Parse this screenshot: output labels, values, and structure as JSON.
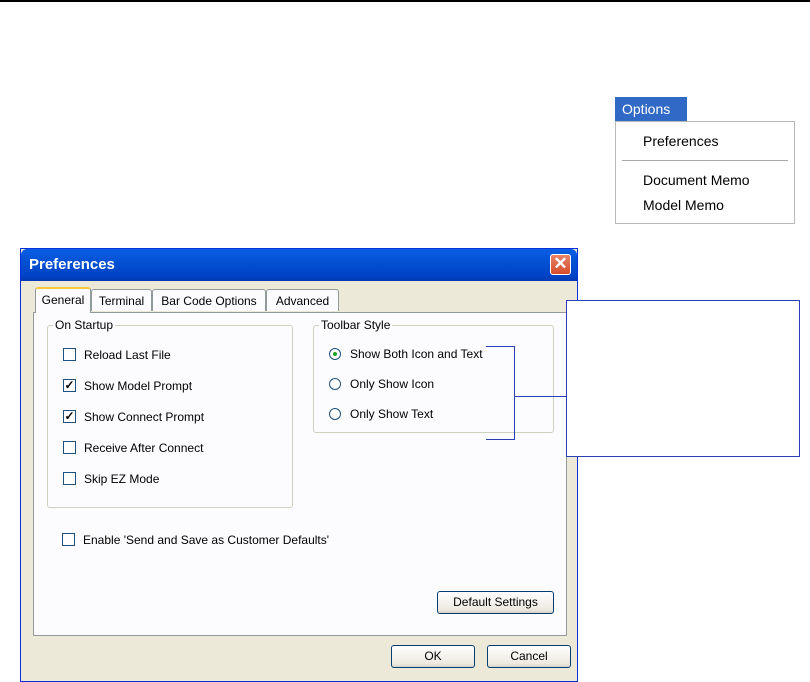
{
  "options_menu": {
    "title": "Options",
    "items": [
      "Preferences",
      "Document Memo",
      "Model Memo"
    ]
  },
  "dialog": {
    "title": "Preferences",
    "close_glyph": "✕",
    "tabs": [
      "General",
      "Terminal",
      "Bar Code Options",
      "Advanced"
    ],
    "active_tab": "General",
    "on_startup": {
      "legend": "On Startup",
      "options": [
        {
          "label": "Reload Last File",
          "checked": false
        },
        {
          "label": "Show Model Prompt",
          "checked": true
        },
        {
          "label": "Show Connect Prompt",
          "checked": true
        },
        {
          "label": "Receive After Connect",
          "checked": false
        },
        {
          "label": "Skip EZ Mode",
          "checked": false
        }
      ]
    },
    "toolbar_style": {
      "legend": "Toolbar Style",
      "options": [
        {
          "label": "Show Both Icon and Text",
          "selected": true
        },
        {
          "label": "Only Show Icon",
          "selected": false
        },
        {
          "label": "Only Show Text",
          "selected": false
        }
      ]
    },
    "enable_send_save": {
      "label": "Enable 'Send and Save as Customer Defaults'",
      "checked": false
    },
    "default_settings_label": "Default Settings",
    "ok_label": "OK",
    "cancel_label": "Cancel"
  },
  "icons": {
    "check": "check-icon",
    "close": "close-icon"
  },
  "colors": {
    "menu_highlight": "#3169c6",
    "title_bar": "#0351d4",
    "callout": "#2a3fb5"
  }
}
